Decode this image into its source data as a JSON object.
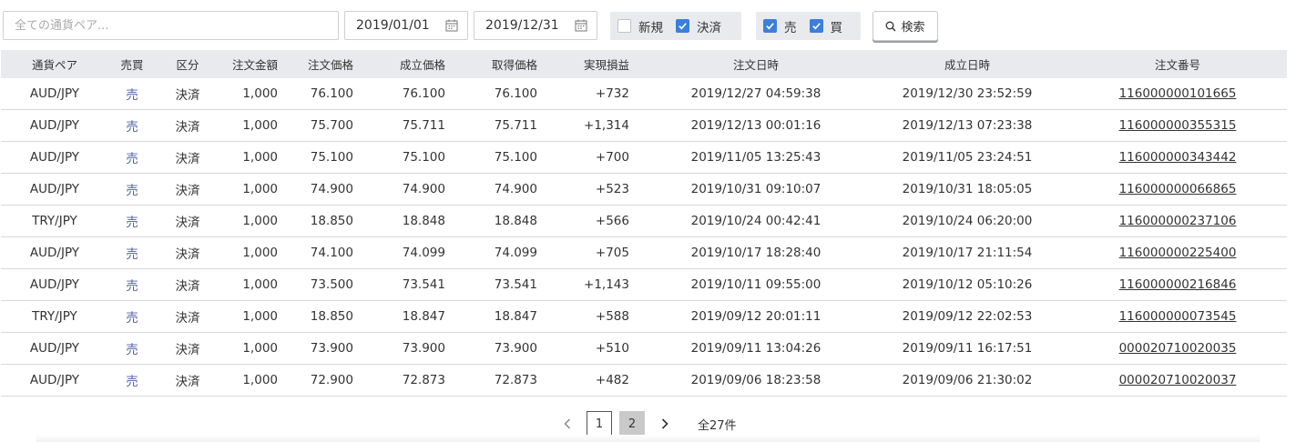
{
  "filters": {
    "search_placeholder": "全ての通貨ペア...",
    "date_from": "2019/01/01",
    "date_to": "2019/12/31",
    "type_new": {
      "label": "新規",
      "checked": false
    },
    "type_settle": {
      "label": "決済",
      "checked": true
    },
    "side_sell": {
      "label": "売",
      "checked": true
    },
    "side_buy": {
      "label": "買",
      "checked": true
    },
    "search_button": "検索"
  },
  "table": {
    "headers": [
      "通貨ペア",
      "売買",
      "区分",
      "注文金額",
      "注文価格",
      "成立価格",
      "取得価格",
      "実現損益",
      "注文日時",
      "成立日時",
      "注文番号"
    ],
    "rows": [
      [
        "AUD/JPY",
        "売",
        "決済",
        "1,000",
        "76.100",
        "76.100",
        "76.100",
        "+732",
        "2019/12/27 04:59:38",
        "2019/12/30 23:52:59",
        "116000000101665"
      ],
      [
        "AUD/JPY",
        "売",
        "決済",
        "1,000",
        "75.700",
        "75.711",
        "75.711",
        "+1,314",
        "2019/12/13 00:01:16",
        "2019/12/13 07:23:38",
        "116000000355315"
      ],
      [
        "AUD/JPY",
        "売",
        "決済",
        "1,000",
        "75.100",
        "75.100",
        "75.100",
        "+700",
        "2019/11/05 13:25:43",
        "2019/11/05 23:24:51",
        "116000000343442"
      ],
      [
        "AUD/JPY",
        "売",
        "決済",
        "1,000",
        "74.900",
        "74.900",
        "74.900",
        "+523",
        "2019/10/31 09:10:07",
        "2019/10/31 18:05:05",
        "116000000066865"
      ],
      [
        "TRY/JPY",
        "売",
        "決済",
        "1,000",
        "18.850",
        "18.848",
        "18.848",
        "+566",
        "2019/10/24 00:42:41",
        "2019/10/24 06:20:00",
        "116000000237106"
      ],
      [
        "AUD/JPY",
        "売",
        "決済",
        "1,000",
        "74.100",
        "74.099",
        "74.099",
        "+705",
        "2019/10/17 18:28:40",
        "2019/10/17 21:11:54",
        "116000000225400"
      ],
      [
        "AUD/JPY",
        "売",
        "決済",
        "1,000",
        "73.500",
        "73.541",
        "73.541",
        "+1,143",
        "2019/10/11 09:55:00",
        "2019/10/12 05:10:26",
        "116000000216846"
      ],
      [
        "TRY/JPY",
        "売",
        "決済",
        "1,000",
        "18.850",
        "18.847",
        "18.847",
        "+588",
        "2019/09/12 20:01:11",
        "2019/09/12 22:02:53",
        "116000000073545"
      ],
      [
        "AUD/JPY",
        "売",
        "決済",
        "1,000",
        "73.900",
        "73.900",
        "73.900",
        "+510",
        "2019/09/11 13:04:26",
        "2019/09/11 16:17:51",
        "000020710020035"
      ],
      [
        "AUD/JPY",
        "売",
        "決済",
        "1,000",
        "72.900",
        "72.873",
        "72.873",
        "+482",
        "2019/09/06 18:23:58",
        "2019/09/06 21:30:02",
        "000020710020037"
      ]
    ]
  },
  "pagination": {
    "pages": [
      "1",
      "2"
    ],
    "current": "2",
    "total": "全27件"
  },
  "icons": {
    "calendar": "calendar-icon",
    "check": "check-icon",
    "search": "magnifier-icon",
    "prev": "chevron-left-icon",
    "next": "chevron-right-icon"
  },
  "colors": {
    "checkbox_on": "#3b7fd9",
    "header_bg": "#e9eaed",
    "side_sell": "#4a5fa8",
    "page_current": "#c9c9c9"
  }
}
